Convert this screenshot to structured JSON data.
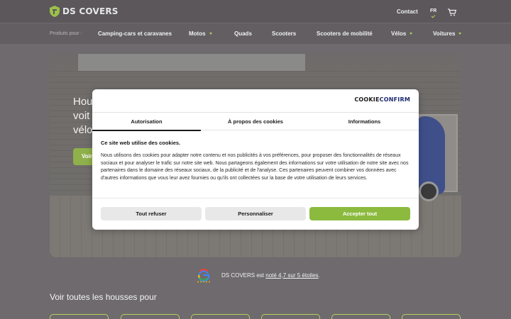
{
  "header": {
    "logo_text": "DS COVERS",
    "contact_label": "Contact",
    "lang_label": "FR"
  },
  "nav": {
    "prefix": "Produits pour :",
    "items": [
      {
        "label": "Camping-cars et caravanes",
        "has_dropdown": false
      },
      {
        "label": "Motos",
        "has_dropdown": true
      },
      {
        "label": "Quads",
        "has_dropdown": false
      },
      {
        "label": "Scooters",
        "has_dropdown": false
      },
      {
        "label": "Scooters de mobilité",
        "has_dropdown": false
      },
      {
        "label": "Vélos",
        "has_dropdown": true
      },
      {
        "label": "Voitures",
        "has_dropdown": true
      }
    ]
  },
  "hero": {
    "title_lines": [
      "Hou",
      "voit",
      "vélo"
    ],
    "button_label": "Voir"
  },
  "rating": {
    "brand": "DS COVERS",
    "text_mid": "est",
    "link_text": "noté 4,7 sur 5 étoiles",
    "suffix": "."
  },
  "see_all": "Voir toutes les housses pour",
  "cookie_dialog": {
    "brand_part1": "COOKIE",
    "brand_part2": "CONFIRM",
    "tabs": [
      "Autorisation",
      "À propos des cookies",
      "Informations"
    ],
    "active_tab": "Autorisation",
    "title": "Ce site web utilise des cookies.",
    "body": "Nous utilisons des cookies pour adapter notre contenu et nos publicités à vos préférences, pour proposer des fonctionnalités de réseaux sociaux et pour analyser le trafic sur notre site web. Nous partageons également des informations sur votre utilisation de notre site avec nos partenaires dans le domaine des réseaux sociaux, de la publicité et de l'analyse. Ces partenaires peuvent combiner vos données avec d'autres informations que vous leur avez fournies ou qu'ils ont collectées sur la base de votre utilisation de leurs services.",
    "btn_refuse": "Tout refuser",
    "btn_customize": "Personnaliser",
    "btn_accept": "Accepter tout"
  },
  "colors": {
    "accent_green": "#8cba3f",
    "brand_blue": "#1d2a6e",
    "overlay_bg": "#6e6a6d"
  }
}
